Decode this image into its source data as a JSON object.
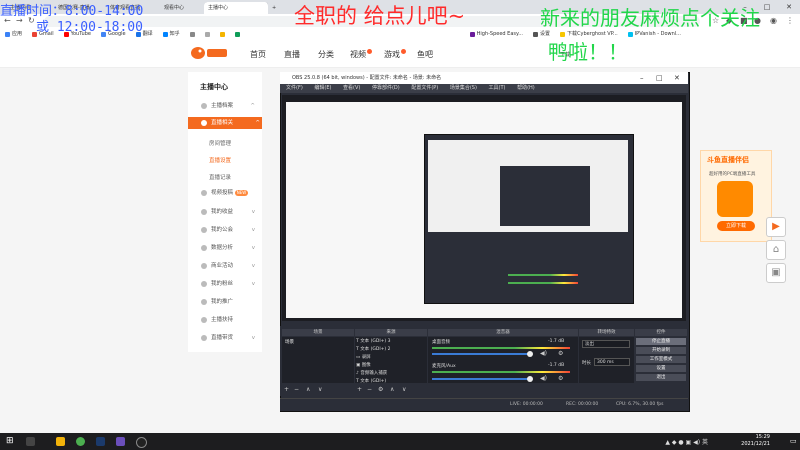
{
  "browser": {
    "tabs": [
      {
        "label": "主播时间"
      },
      {
        "label": "德国比赛-直播"
      },
      {
        "label": "体育观看直播"
      },
      {
        "label": "观看中心"
      },
      {
        "label": "主播中心"
      }
    ],
    "url": "",
    "bookmarks": [
      "应用",
      "Gmail",
      "YouTube",
      "Google",
      "翻译",
      "知乎",
      "",
      "",
      "",
      "",
      "High-Speed Easy...",
      "设置",
      "下载Cyberghost VP...",
      "IPVanish - Downl..."
    ]
  },
  "overlay": {
    "schedule_line1": "直播时间：8:00-14:00",
    "schedule_line2": "或 12:00-18:00",
    "red_text": "全职的 给点儿吧~",
    "green_line1": "新来的朋友麻烦点个关注",
    "green_line2": "鸭啦！！"
  },
  "site": {
    "nav": [
      "首页",
      "直播",
      "分类",
      "视频",
      "游戏",
      "鱼吧"
    ],
    "download": "下载",
    "sidebar_title": "主播中心",
    "sidebar": [
      {
        "label": "主播档案"
      },
      {
        "label": "直播相关"
      },
      {
        "label": "视频投稿"
      },
      {
        "label": "我的收益"
      },
      {
        "label": "我的公会"
      },
      {
        "label": "数据分析"
      },
      {
        "label": "商业活动"
      },
      {
        "label": "我的粉丝"
      },
      {
        "label": "我的推广"
      },
      {
        "label": "主播扶持"
      },
      {
        "label": "直播带货"
      }
    ],
    "subitems": [
      "房间管理",
      "直播设置",
      "直播记录"
    ],
    "new_badge": "NEW",
    "ad": {
      "title": "斗鱼直播伴侣",
      "line": "超好用的PC端直播工具",
      "button": "立即下载"
    }
  },
  "obs": {
    "title": "OBS 25.0.8 (64 bit, windows) - 配置文件: 未命名 - 场景: 未命名",
    "menu": [
      "文件(F)",
      "编辑(E)",
      "查看(V)",
      "停靠部件(D)",
      "配置文件(P)",
      "场景集合(S)",
      "工具(T)",
      "帮助(H)"
    ],
    "docks": [
      "场景",
      "来源",
      "混音器",
      "转场特效",
      "控件"
    ],
    "scene": "场景",
    "sources": [
      "文本 (GDI+) 3",
      "文本 (GDI+) 2",
      "录屏",
      "图像",
      "音频输入捕获",
      "文本 (GDI+)"
    ],
    "mixer": [
      {
        "name": "桌面音频",
        "level": "-1.7 dB"
      },
      {
        "name": "麦克风/Aux",
        "level": "-1.7 dB"
      }
    ],
    "transition": {
      "name": "淡出",
      "duration_label": "时长",
      "duration": "300 ms"
    },
    "controls": [
      "停止直播",
      "开始录制",
      "工作室模式",
      "设置",
      "退出"
    ],
    "status": {
      "live": "LIVE: 00:00:00",
      "rec": "REC: 00:00:00",
      "cpu": "CPU: 6.7%, 30.00 fps"
    }
  },
  "taskbar": {
    "time": "15:29",
    "date": "2021/12/21",
    "lang": "英"
  },
  "colors": {
    "accent": "#f46a1f",
    "obs_bg": "#2b2e38",
    "overlay_red": "#ff2b2b",
    "overlay_green": "#21d64a",
    "overlay_blue": "#3a5fff"
  }
}
